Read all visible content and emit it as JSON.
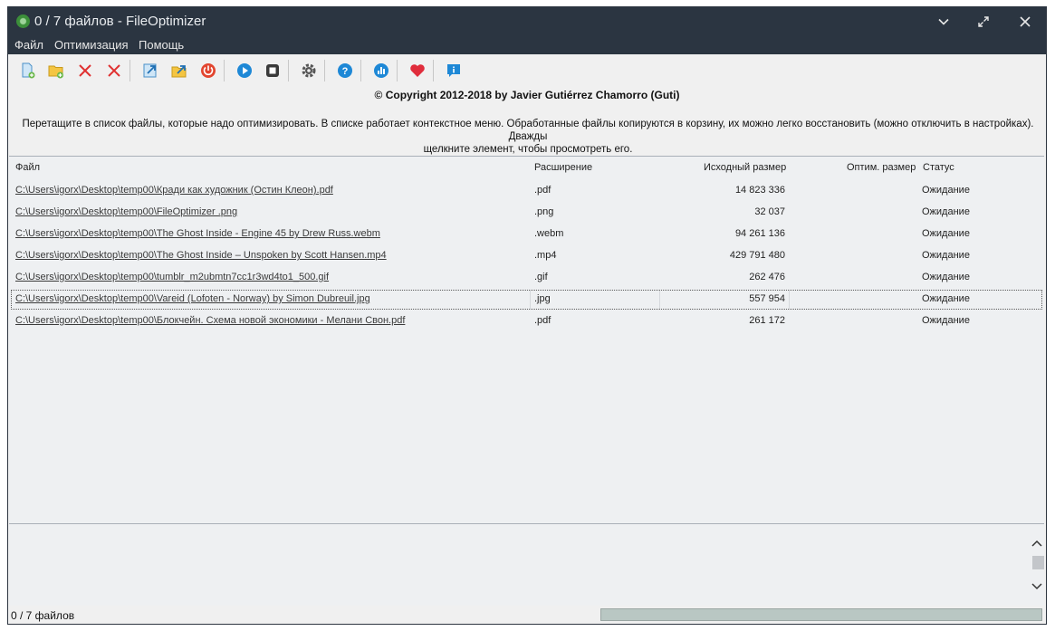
{
  "window": {
    "title": "0 / 7 файлов - FileOptimizer"
  },
  "menu": {
    "file": "Файл",
    "optimize": "Оптимизация",
    "help": "Помощь"
  },
  "toolbar": {
    "icons": [
      "add-files-icon",
      "add-folder-icon",
      "remove-icon",
      "clear-icon",
      "open-icon",
      "open-folder-icon",
      "power-icon",
      "play-icon",
      "stop-icon",
      "settings-icon",
      "help-icon",
      "stats-icon",
      "donate-heart-icon",
      "info-icon"
    ]
  },
  "copyright": "© Copyright 2012-2018 by Javier Gutiérrez Chamorro (Guti)",
  "hint": {
    "line1": "Перетащите в список файлы, которые надо оптимизировать. В списке работает контекстное меню. Обработанные файлы копируются в корзину, их можно легко восстановить (можно отключить в настройках). Дважды",
    "line2": "щелкните элемент, чтобы просмотреть его."
  },
  "list": {
    "headers": {
      "file": "Файл",
      "ext": "Расширение",
      "orig": "Исходный размер",
      "optim": "Оптим. размер",
      "status": "Статус"
    },
    "rows": [
      {
        "file": "C:\\Users\\igorx\\Desktop\\temp00\\Кради как художник (Остин Клеон).pdf",
        "ext": ".pdf",
        "orig": "14 823 336",
        "status": "Ожидание"
      },
      {
        "file": "C:\\Users\\igorx\\Desktop\\temp00\\FileOptimizer .png",
        "ext": ".png",
        "orig": "32 037",
        "status": "Ожидание"
      },
      {
        "file": "C:\\Users\\igorx\\Desktop\\temp00\\The Ghost Inside - Engine 45 by Drew Russ.webm",
        "ext": ".webm",
        "orig": "94 261 136",
        "status": "Ожидание"
      },
      {
        "file": "C:\\Users\\igorx\\Desktop\\temp00\\The Ghost Inside – Unspoken by Scott Hansen.mp4",
        "ext": ".mp4",
        "orig": "429 791 480",
        "status": "Ожидание"
      },
      {
        "file": "C:\\Users\\igorx\\Desktop\\temp00\\tumblr_m2ubmtn7cc1r3wd4to1_500.gif",
        "ext": ".gif",
        "orig": "262 476",
        "status": "Ожидание"
      },
      {
        "file": "C:\\Users\\igorx\\Desktop\\temp00\\Vareid (Lofoten - Norway) by Simon Dubreuil.jpg",
        "ext": ".jpg",
        "orig": "557 954",
        "status": "Ожидание"
      },
      {
        "file": "C:\\Users\\igorx\\Desktop\\temp00\\Блокчейн. Схема новой экономики - Мелани Свон.pdf",
        "ext": ".pdf",
        "orig": "261 172",
        "status": "Ожидание"
      }
    ]
  },
  "statusbar": {
    "text": "0 / 7 файлов",
    "progress_fraction": 0
  }
}
